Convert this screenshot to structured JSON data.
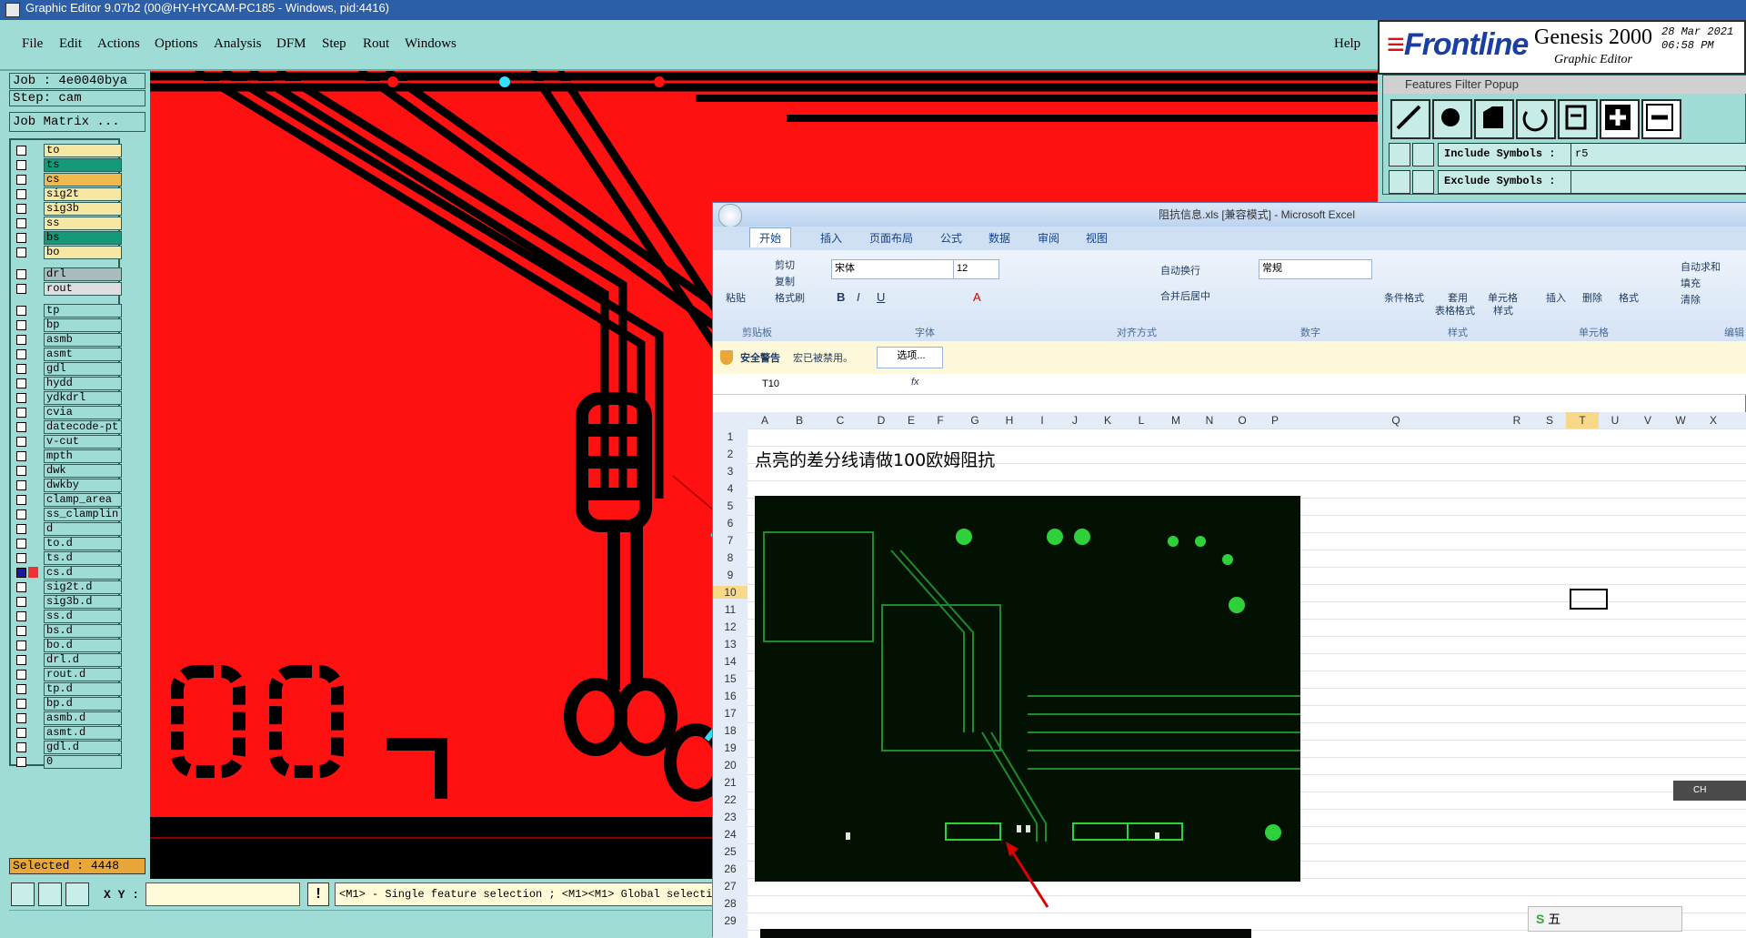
{
  "window": {
    "title": "Graphic Editor 9.07b2 (00@HY-HYCAM-PC185 - Windows, pid:4416)"
  },
  "menu": {
    "items": [
      "File",
      "Edit",
      "Actions",
      "Options",
      "Analysis",
      "DFM",
      "Step",
      "Rout",
      "Windows"
    ],
    "help": "Help"
  },
  "logo": {
    "brand": "Frontline",
    "product": "Genesis 2000",
    "subtitle": "Graphic Editor",
    "date": "28 Mar 2021",
    "time": "06:58 PM"
  },
  "job": {
    "job_line": "Job : 4e0040bya",
    "step_line": "Step: cam",
    "matrix_button": "Job Matrix ..."
  },
  "layers": [
    {
      "name": "to",
      "color": "#f6e7a5"
    },
    {
      "name": "ts",
      "color": "#159a78"
    },
    {
      "name": "cs",
      "color": "#f1b94e"
    },
    {
      "name": "sig2t",
      "color": "#f6e7a5"
    },
    {
      "name": "sig3b",
      "color": "#f6e7a5"
    },
    {
      "name": "ss",
      "color": "#f6e7a5"
    },
    {
      "name": "bs",
      "color": "#159a78"
    },
    {
      "name": "bo",
      "color": "#f6e7a5"
    },
    {
      "name": "drl",
      "color": "#a9bcbc"
    },
    {
      "name": "rout",
      "color": "#dedede"
    },
    {
      "name": "tp",
      "color": "#9fdcd6"
    },
    {
      "name": "bp",
      "color": "#9fdcd6"
    },
    {
      "name": "asmb",
      "color": "#9fdcd6"
    },
    {
      "name": "asmt",
      "color": "#9fdcd6"
    },
    {
      "name": "gdl",
      "color": "#9fdcd6"
    },
    {
      "name": "hydd",
      "color": "#9fdcd6"
    },
    {
      "name": "ydkdrl",
      "color": "#9fdcd6"
    },
    {
      "name": "cvia",
      "color": "#9fdcd6"
    },
    {
      "name": "datecode-pt",
      "color": "#9fdcd6"
    },
    {
      "name": "v-cut",
      "color": "#9fdcd6"
    },
    {
      "name": "mpth",
      "color": "#9fdcd6"
    },
    {
      "name": "dwk",
      "color": "#9fdcd6"
    },
    {
      "name": "dwkby",
      "color": "#9fdcd6"
    },
    {
      "name": "clamp_area",
      "color": "#9fdcd6"
    },
    {
      "name": "ss_clamplin",
      "color": "#9fdcd6"
    },
    {
      "name": "d",
      "color": "#9fdcd6"
    },
    {
      "name": "to.d",
      "color": "#9fdcd6"
    },
    {
      "name": "ts.d",
      "color": "#9fdcd6"
    },
    {
      "name": "cs.d",
      "color": "#9fdcd6"
    },
    {
      "name": "sig2t.d",
      "color": "#9fdcd6"
    },
    {
      "name": "sig3b.d",
      "color": "#9fdcd6"
    },
    {
      "name": "ss.d",
      "color": "#9fdcd6"
    },
    {
      "name": "bs.d",
      "color": "#9fdcd6"
    },
    {
      "name": "bo.d",
      "color": "#9fdcd6"
    },
    {
      "name": "drl.d",
      "color": "#9fdcd6"
    },
    {
      "name": "rout.d",
      "color": "#9fdcd6"
    },
    {
      "name": "tp.d",
      "color": "#9fdcd6"
    },
    {
      "name": "bp.d",
      "color": "#9fdcd6"
    },
    {
      "name": "asmb.d",
      "color": "#9fdcd6"
    },
    {
      "name": "asmt.d",
      "color": "#9fdcd6"
    },
    {
      "name": "gdl.d",
      "color": "#9fdcd6"
    },
    {
      "name": "0",
      "color": "#9fdcd6"
    }
  ],
  "selected": "Selected : 4448",
  "status": {
    "xy_label": "X Y :",
    "hint": "<M1> - Single feature selection ; <M1><M1> Global selection"
  },
  "features_filter": {
    "title": "Features Filter Popup",
    "include_label": "Include Symbols :",
    "include_value": "r5",
    "exclude_label": "Exclude Symbols :",
    "exclude_value": ""
  },
  "excel": {
    "title": "阻抗信息.xls [兼容模式] - Microsoft Excel",
    "tabs": [
      "开始",
      "插入",
      "页面布局",
      "公式",
      "数据",
      "审阅",
      "视图"
    ],
    "clipboard": {
      "paste": "粘贴",
      "cut": "剪切",
      "copy": "复制",
      "format_painter": "格式刷",
      "group": "剪贴板"
    },
    "font": {
      "name": "宋体",
      "size": "12",
      "group": "字体"
    },
    "alignment": {
      "wrap": "自动换行",
      "merge": "合并后居中",
      "group": "对齐方式"
    },
    "number": {
      "format": "常规",
      "group": "数字"
    },
    "styles": {
      "cond": "条件格式",
      "table1": "套用",
      "table2": "表格格式",
      "cell1": "单元格",
      "cell2": "样式",
      "group": "样式"
    },
    "cells": {
      "insert": "插入",
      "delete": "删除",
      "format": "格式",
      "group": "单元格"
    },
    "editing": {
      "autosum": "自动求和",
      "fill": "填充",
      "clear": "清除",
      "group": "编辑"
    },
    "security": {
      "label": "安全警告",
      "message": "宏已被禁用。",
      "button": "选项..."
    },
    "name_box": "T10",
    "fx": "fx",
    "columns": [
      "A",
      "B",
      "C",
      "D",
      "E",
      "F",
      "G",
      "H",
      "I",
      "J",
      "K",
      "L",
      "M",
      "N",
      "O",
      "P",
      "Q",
      "R",
      "S",
      "T",
      "U",
      "V",
      "W",
      "X"
    ],
    "rows": [
      "1",
      "2",
      "3",
      "4",
      "5",
      "6",
      "7",
      "8",
      "9",
      "10",
      "11",
      "12",
      "13",
      "14",
      "15",
      "16",
      "17",
      "18",
      "19",
      "20",
      "21",
      "22",
      "23",
      "24",
      "25",
      "26",
      "27",
      "28",
      "29"
    ],
    "cell_text": "点亮的差分线请做100欧姆阻抗"
  },
  "ime": {
    "label": "五"
  },
  "ch_widget": {
    "label": "CH"
  }
}
